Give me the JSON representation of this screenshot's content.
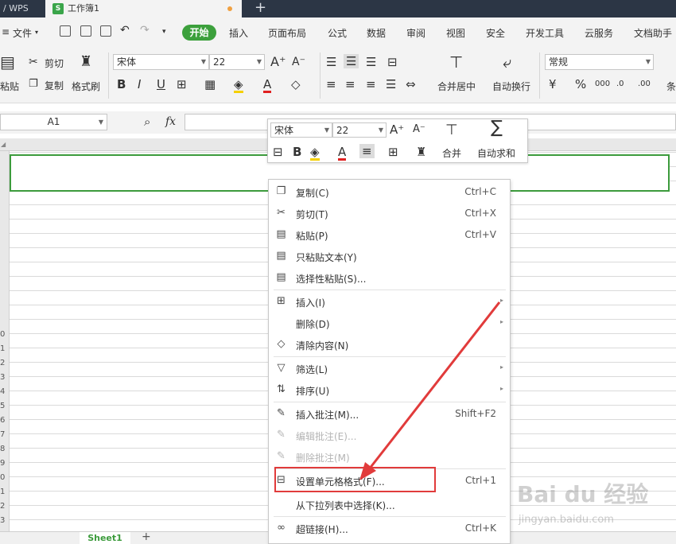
{
  "titlebar": {
    "app_tab": "/ WPS",
    "doc_tab": "工作簿1",
    "doc_icon_letter": "S",
    "new_tab": "+"
  },
  "menubar": {
    "file_label": "文件",
    "start_label": "开始",
    "items": [
      "插入",
      "页面布局",
      "公式",
      "数据",
      "审阅",
      "视图",
      "安全",
      "开发工具",
      "云服务",
      "文档助手"
    ]
  },
  "ribbon": {
    "paste_label": "粘贴",
    "cut_label": "剪切",
    "copy_label": "复制",
    "format_painter_label": "格式刷",
    "font_name": "宋体",
    "font_size": "22",
    "merge_label": "合并居中",
    "wrap_label": "自动换行",
    "number_format": "常规",
    "cond_label": "条"
  },
  "formula": {
    "cell_ref": "A1",
    "fx": "fx"
  },
  "row_numbers": [
    "0",
    "1",
    "2",
    "3",
    "4",
    "5",
    "6",
    "7",
    "8",
    "9",
    "0",
    "1",
    "2",
    "3"
  ],
  "mini_toolbar": {
    "font_name": "宋体",
    "font_size": "22",
    "merge_label": "合并",
    "autosum_label": "自动求和"
  },
  "context_menu": {
    "items": [
      {
        "label": "复制(C)",
        "shortcut": "Ctrl+C"
      },
      {
        "label": "剪切(T)",
        "shortcut": "Ctrl+X"
      },
      {
        "label": "粘贴(P)",
        "shortcut": "Ctrl+V"
      },
      {
        "label": "只粘贴文本(Y)",
        "shortcut": ""
      },
      {
        "label": "选择性粘贴(S)...",
        "shortcut": ""
      },
      {
        "label": "插入(I)",
        "shortcut": ""
      },
      {
        "label": "删除(D)",
        "shortcut": ""
      },
      {
        "label": "清除内容(N)",
        "shortcut": ""
      },
      {
        "label": "筛选(L)",
        "shortcut": ""
      },
      {
        "label": "排序(U)",
        "shortcut": ""
      },
      {
        "label": "插入批注(M)...",
        "shortcut": "Shift+F2"
      },
      {
        "label": "编辑批注(E)...",
        "shortcut": ""
      },
      {
        "label": "删除批注(M)",
        "shortcut": ""
      },
      {
        "label": "设置单元格格式(F)...",
        "shortcut": "Ctrl+1"
      },
      {
        "label": "从下拉列表中选择(K)...",
        "shortcut": ""
      },
      {
        "label": "超链接(H)...",
        "shortcut": "Ctrl+K"
      }
    ]
  },
  "sheets": {
    "active": "Sheet1",
    "add": "+"
  },
  "watermark": {
    "brand": "Bai du 经验",
    "url": "jingyan.baidu.com"
  },
  "colors": {
    "accent_green": "#3ca03c",
    "annotation_red": "#e13b3b",
    "titlebar_bg": "#2c3645"
  }
}
